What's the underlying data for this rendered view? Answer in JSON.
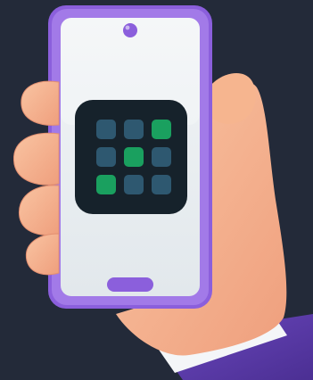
{
  "colors": {
    "background": "#232a39",
    "phone_frame": "#8b5fdc",
    "phone_frame_light": "#a27ae8",
    "screen": "#e9eef1",
    "camera_dot": "#8b5fdc",
    "home_bar": "#8b5fdc",
    "app_icon_bg": "#16222b",
    "tile_inactive": "#2e5870",
    "tile_active": "#1aa05f",
    "skin": "#f6b58f",
    "skin_shadow": "#e38f70",
    "sleeve": "#5a3aa8",
    "cuff": "#f4f6f8"
  },
  "app_icon": {
    "icon": "grid-apps-icon",
    "grid": [
      [
        false,
        false,
        true
      ],
      [
        false,
        true,
        false
      ],
      [
        true,
        false,
        false
      ]
    ]
  },
  "phone": {
    "camera_icon": "front-camera-icon",
    "home_indicator_icon": "home-indicator-icon"
  }
}
